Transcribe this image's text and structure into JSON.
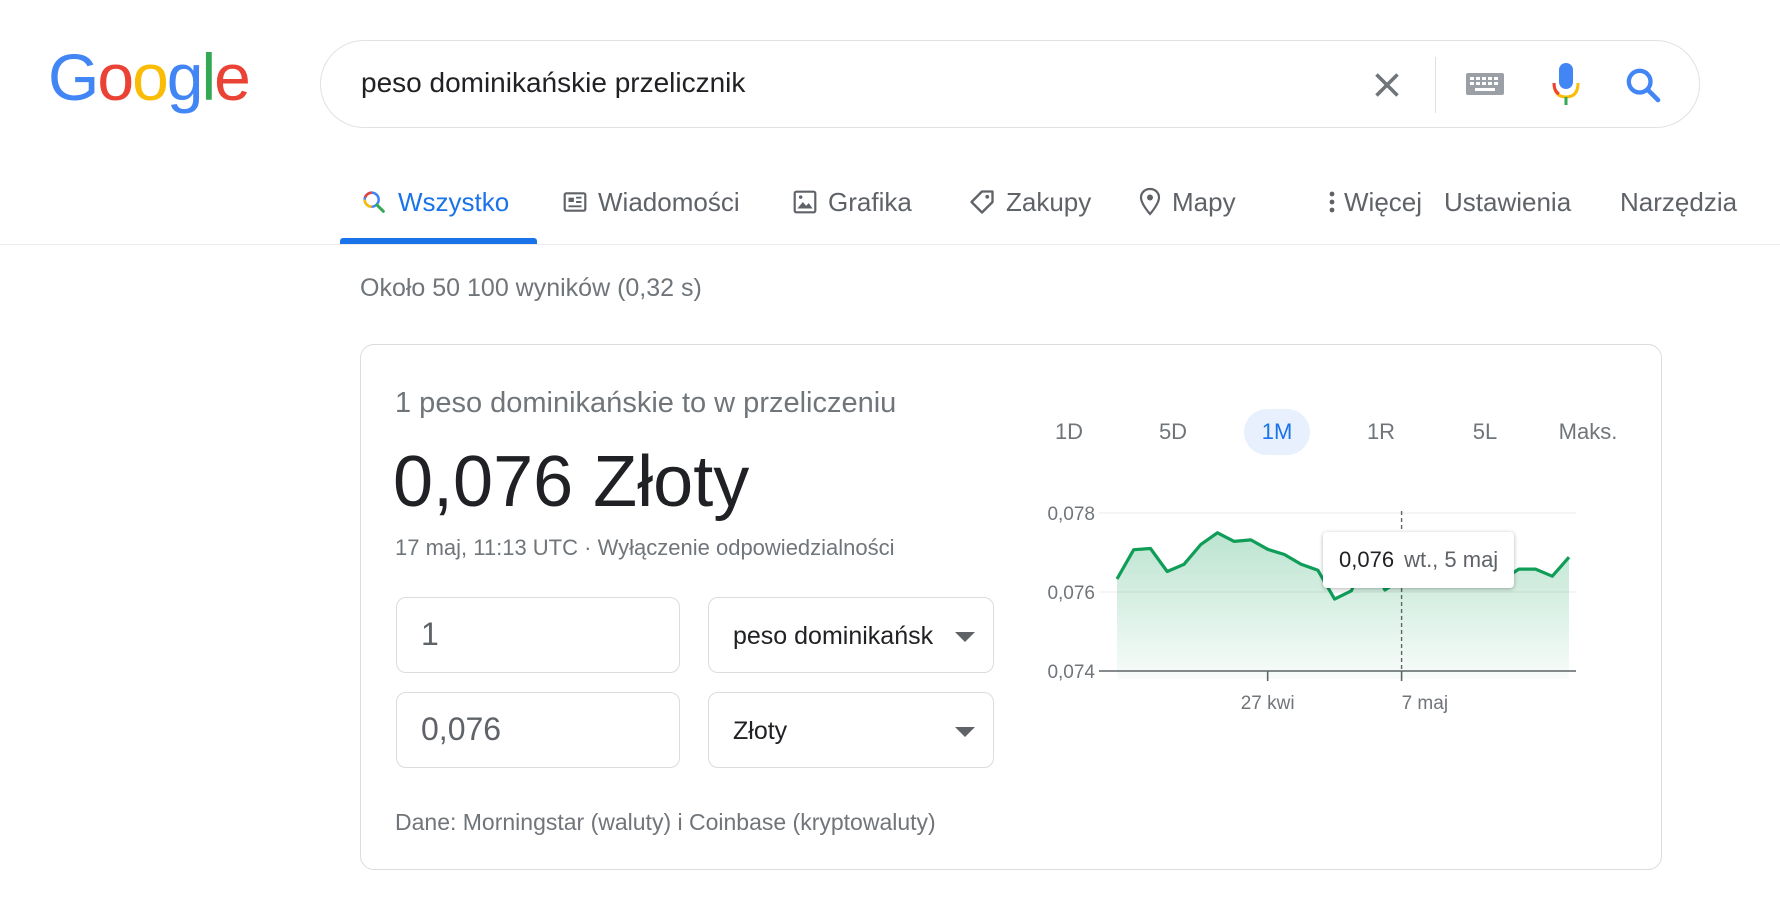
{
  "logo": {
    "letters": [
      "G",
      "o",
      "o",
      "g",
      "l",
      "e"
    ],
    "colors": [
      "#4285F4",
      "#EA4335",
      "#FBBC05",
      "#4285F4",
      "#34A853",
      "#EA4335"
    ]
  },
  "search": {
    "query": "peso dominikańskie przelicznik"
  },
  "icons": {
    "clear": "close-icon",
    "keyboard": "keyboard-icon",
    "voice": "microphone-icon",
    "search": "search-icon"
  },
  "tabs": [
    {
      "label": "Wszystko",
      "icon": "search-icon",
      "active": true
    },
    {
      "label": "Wiadomości",
      "icon": "news-icon"
    },
    {
      "label": "Grafika",
      "icon": "image-icon"
    },
    {
      "label": "Zakupy",
      "icon": "tag-icon"
    },
    {
      "label": "Mapy",
      "icon": "map-pin-icon"
    },
    {
      "label": "Więcej",
      "icon": "more-vert-icon"
    },
    {
      "label": "Ustawienia"
    },
    {
      "label": "Narzędzia"
    }
  ],
  "results": {
    "stats": "Około 50 100 wyników (0,32 s)"
  },
  "converter": {
    "label": "1 peso dominikańskie to w przeliczeniu",
    "value": "0,076 Złoty",
    "timestamp": "17 maj, 11:13 UTC",
    "separator": " · ",
    "disclaimer": "Wyłączenie odpowiedzialności",
    "from_amount": "1",
    "from_currency": "peso dominikańskie",
    "to_amount": "0,076",
    "to_currency": "Złoty",
    "source": "Dane: Morningstar (waluty) i Coinbase (kryptowaluty)"
  },
  "ranges": {
    "items": [
      "1D",
      "5D",
      "1M",
      "1R",
      "5L",
      "Maks."
    ],
    "active": "1M"
  },
  "tooltip": {
    "value": "0,076",
    "date": "wt., 5 maj"
  },
  "chart_data": {
    "type": "area",
    "y_ticks": [
      "0,078",
      "0,076",
      "0,074"
    ],
    "ylim": [
      0.074,
      0.078
    ],
    "x_ticks": [
      {
        "label": "27 kwi",
        "index": 9
      },
      {
        "label": "7 maj",
        "index": 17
      }
    ],
    "values": [
      0.07633,
      0.07707,
      0.0771,
      0.07652,
      0.0767,
      0.0772,
      0.0775,
      0.07728,
      0.07732,
      0.07708,
      0.07695,
      0.0767,
      0.07655,
      0.07582,
      0.07603,
      0.07705,
      0.07605,
      0.07633,
      0.07685,
      0.07655,
      0.07645,
      0.0771,
      0.0765,
      0.0763,
      0.07658,
      0.07658,
      0.0764,
      0.07688
    ],
    "highlight_index": 17,
    "colors": {
      "line": "#0f9d58",
      "fill": "#0f9d58"
    }
  }
}
